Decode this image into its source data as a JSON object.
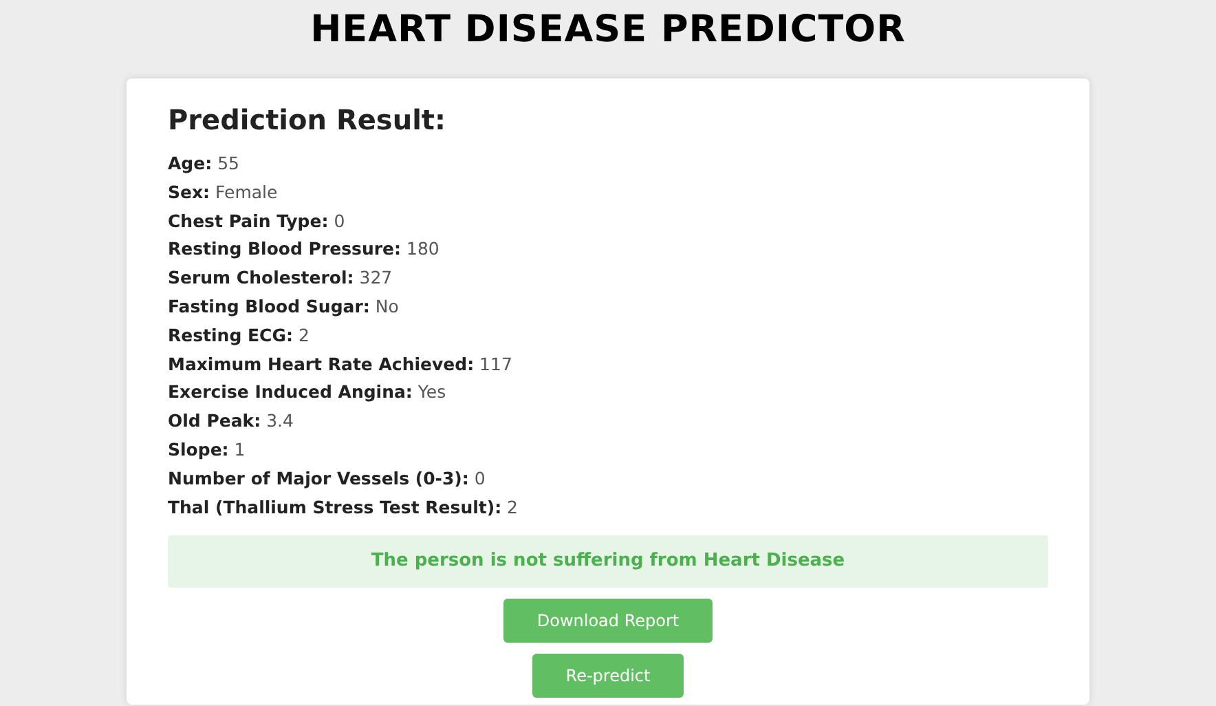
{
  "title": "HEART DISEASE PREDICTOR",
  "result": {
    "heading": "Prediction Result:",
    "fields": [
      {
        "label": "Age:",
        "value": "55"
      },
      {
        "label": "Sex:",
        "value": "Female"
      },
      {
        "label": "Chest Pain Type:",
        "value": "0"
      },
      {
        "label": "Resting Blood Pressure:",
        "value": "180"
      },
      {
        "label": "Serum Cholesterol:",
        "value": "327"
      },
      {
        "label": "Fasting Blood Sugar:",
        "value": "No"
      },
      {
        "label": "Resting ECG:",
        "value": "2"
      },
      {
        "label": "Maximum Heart Rate Achieved:",
        "value": "117"
      },
      {
        "label": "Exercise Induced Angina:",
        "value": "Yes"
      },
      {
        "label": "Old Peak:",
        "value": "3.4"
      },
      {
        "label": "Slope:",
        "value": "1"
      },
      {
        "label": "Number of Major Vessels (0-3):",
        "value": "0"
      },
      {
        "label": "Thal (Thallium Stress Test Result):",
        "value": "2"
      }
    ],
    "message": "The person is not suffering from Heart Disease",
    "buttons": [
      "Download Report",
      "Re-predict"
    ]
  }
}
